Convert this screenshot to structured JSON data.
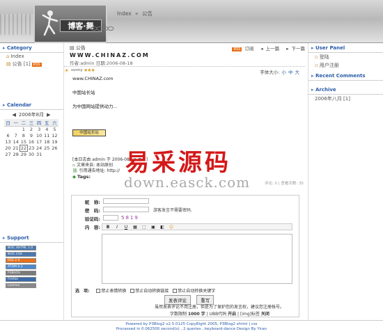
{
  "header": {
    "logo_text": "博客·舞",
    "breadcrumb": [
      "Index",
      "»",
      "公告"
    ]
  },
  "left": {
    "category_title": "Category",
    "categories": [
      {
        "label": "Index"
      },
      {
        "label": "公告 [1]",
        "badge": "RSS"
      }
    ],
    "calendar_title": "Calendar",
    "calendar": {
      "prev": "◀",
      "month": "2006年8月",
      "next": "▶",
      "weekdays": [
        "日",
        "一",
        "二",
        "三",
        "四",
        "五",
        "六"
      ],
      "weeks": [
        [
          "",
          "",
          "1",
          "2",
          "3",
          "4",
          "5"
        ],
        [
          "6",
          "7",
          "8",
          "9",
          "10",
          "11",
          "12"
        ],
        [
          "13",
          "14",
          "15",
          "16",
          "17",
          "18",
          "19"
        ],
        [
          "20",
          "21",
          "22",
          "23",
          "24",
          "25",
          "26"
        ],
        [
          "27",
          "28",
          "29",
          "30",
          "31",
          "",
          ""
        ]
      ],
      "today": "22"
    },
    "support_title": "Support",
    "support_badges": [
      {
        "label": "W3C XHTML 1.0",
        "color": "#4a78b0"
      },
      {
        "label": "W3C CSS",
        "color": "#4a78b0"
      },
      {
        "label": "RSS 2.0",
        "color": "#e8701a"
      },
      {
        "label": "ATOM 0.3",
        "color": "#4a8ad0"
      },
      {
        "label": "P3BLOG",
        "color": "#7a7a7a"
      },
      {
        "label": "Firefox",
        "color": "#3a6aa8"
      },
      {
        "label": "Licence",
        "color": "#888888"
      }
    ]
  },
  "post": {
    "category": "公告",
    "rss_label": "RSS",
    "subscribe": "订阅",
    "prev": "上一篇",
    "next": "下一篇",
    "title": "WWW.CHINAZ.COM",
    "meta": "作者:admin 日期:2006-08-18",
    "mood_label": "sunny",
    "mood_stars": "★★★",
    "font_size_label": "字体大小:",
    "font_sizes": [
      "小",
      "中",
      "大"
    ],
    "content": [
      "www.CHINAZ.com",
      "中国站长站",
      "为中国网站提供动力..."
    ],
    "content_image_label": "中国站长站",
    "info_lines": [
      "[本日志由 admin 于 2006-08-18 发表]",
      "文章来自: 本站原创",
      "引用通告地址: http://"
    ],
    "tags_label": "Tags:",
    "stats": "评论: 0 | 查看次数: 35"
  },
  "watermark": {
    "cn": "易采源码",
    "en": "down.easck.com"
  },
  "form": {
    "nick_label": "昵　称:",
    "pass_label": "密　码:",
    "pass_hint": "游客发言不需要密码.",
    "captcha_label": "验证码:",
    "captcha_value": "5819",
    "content_label": "内　容:",
    "toolbar": [
      "B",
      "I",
      "U",
      "▦",
      "⬚",
      "▣",
      "◧",
      "☺"
    ],
    "options_label": "选　项:",
    "options": [
      "禁止表情转换",
      "禁止自动转换链接",
      "禁止自动转换关键字"
    ],
    "submit": "发表评论",
    "reset": "重写",
    "notice": "虽然发表评论不用注册，但是为了保护您的发言权，建议您注册帐号。",
    "limit_label": "字数限制",
    "limit_value": "1000 字",
    "ubb_label": "UBB代码",
    "ubb_state": "开启",
    "img_label": "[img]标签",
    "img_state": "关闭"
  },
  "footer": {
    "line1": "Powered by P3Blog2 v2.5.0125 CopyRight 2005, P3Blog2 xhtml | css",
    "line2": "Processed in 0.062500 second(s) , 2 queries , keyboard-dance Design By Yiran"
  },
  "right": {
    "user_panel_title": "User Panel",
    "user_panel_items": [
      "登陆",
      "用户注册"
    ],
    "recent_comments_title": "Recent Comments",
    "archive_title": "Archive",
    "archive_items": [
      "2006年八月 [1]"
    ]
  }
}
